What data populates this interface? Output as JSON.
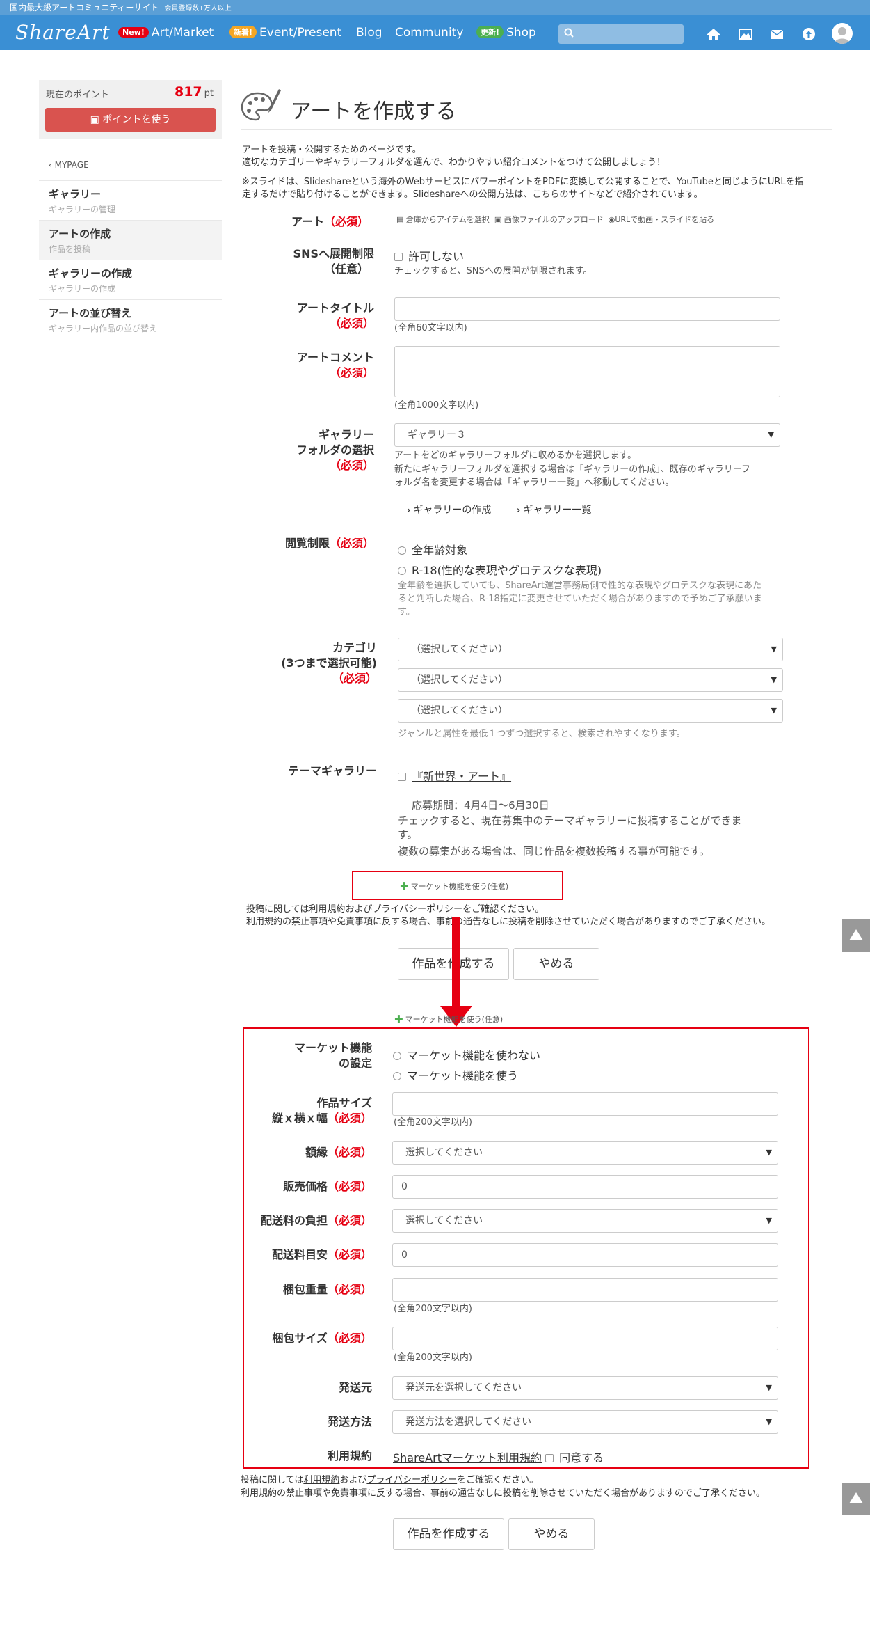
{
  "header": {
    "site_tagline": "国内最大級アートコミュニティーサイト",
    "member_count": "会員登録数1万人以上",
    "logo": "ShareArt",
    "nav": [
      {
        "badge": "New!",
        "label": "Art/Market"
      },
      {
        "badge": "新着!",
        "label": "Event/Present"
      },
      {
        "label": "Blog"
      },
      {
        "label": "Community"
      },
      {
        "badge": "更新!",
        "label": "Shop"
      }
    ],
    "search_placeholder": "",
    "icons": [
      "search-icon",
      "home-icon",
      "gallery-icon",
      "mail-icon",
      "upload-icon",
      "avatar"
    ]
  },
  "sidebar": {
    "points_label": "現在のポイント",
    "points_value": "817",
    "points_unit": "pt",
    "use_points_button": "ポイントを使う",
    "back_link": "MYPAGE",
    "items": [
      {
        "title": "ギャラリー",
        "sub": "ギャラリーの管理"
      },
      {
        "title": "アートの作成",
        "sub": "作品を投稿"
      },
      {
        "title": "ギャラリーの作成",
        "sub": "ギャラリーの作成"
      },
      {
        "title": "アートの並び替え",
        "sub": "ギャラリー内作品の並び替え"
      }
    ]
  },
  "main": {
    "title": "アートを作成する",
    "intro_line1": "アートを投稿・公開するためのページです。",
    "intro_line2": "適切なカテゴリーやギャラリーフォルダを選んで、わかりやすい紹介コメントをつけて公開しましょう！",
    "intro_line3": "※スライドは、Slideshareという海外のWebサービスにパワーポイントをPDFに変換して公開することで、YouTubeと同じようにURLを指",
    "intro_line4a": "定するだけで貼り付けることができます。Slideshareへの公開方法は、",
    "intro_line4_link": "こちらのサイト",
    "intro_line4b": "などで紹介されています。",
    "required": "（必須）",
    "optional_label": "（任意）",
    "art_label": "アート",
    "art_options": [
      "倉庫からアイテムを選択",
      "画像ファイルのアップロード",
      "URLで動画・スライドを貼る"
    ],
    "sns_label": "SNSへ展開制限",
    "sns_checkbox": "許可しない",
    "sns_hint": "チェックすると、SNSへの展開が制限されます。",
    "title_label": "アートタイトル",
    "title_hint": "(全角60文字以内)",
    "comment_label": "アートコメント",
    "comment_hint": "(全角1000文字以内)",
    "gallery_label1": "ギャラリー",
    "gallery_label2": "フォルダの選択",
    "gallery_selected": "ギャラリー３",
    "gallery_hint1": "アートをどのギャラリーフォルダに収めるかを選択します。",
    "gallery_hint2": "新たにギャラリーフォルダを選択する場合は「ギャラリーの作成」、既存のギャラリーフ",
    "gallery_hint3": "ォルダ名を変更する場合は「ギャラリー一覧」へ移動してください。",
    "gallery_link_create": "ギャラリーの作成",
    "gallery_link_list": "ギャラリー一覧",
    "rating_label": "閲覧制限",
    "rating_options": [
      "全年齢対象",
      "R-18(性的な表現やグロテスクな表現)"
    ],
    "rating_hint1": "全年齢を選択していても、ShareArt運営事務局側で性的な表現やグロテスクな表現にあた",
    "rating_hint2": "ると判断した場合、R-18指定に変更させていただく場合がありますので予めご了承願いま",
    "rating_hint3": "す。",
    "category_label1": "カテゴリ",
    "category_label2": "(3つまで選択可能)",
    "category_placeholder": "（選択してください）",
    "category_hint": "ジャンルと属性を最低１つずつ選択すると、検索されやすくなります。",
    "theme_label": "テーマギャラリー",
    "theme_link": "『新世界・アート』",
    "theme_period": "応募期間：4月4日〜6月30日",
    "theme_hint1": "チェックすると、現在募集中のテーマギャラリーに投稿することができま",
    "theme_hint2": "す。",
    "theme_hint3": "複数の募集がある場合は、同じ作品を複数投稿する事が可能です。",
    "market_toggle": "マーケット機能を使う(任意)",
    "terms_line1a": "投稿に関しては",
    "terms_link1": "利用規約",
    "terms_line1b": "および",
    "terms_link2": "プライバシーポリシー",
    "terms_line1c": "をご確認ください。",
    "terms_line2": "利用規約の禁止事項や免責事項に反する場合、事前の通告なしに投稿を削除させていただく場合がありますのでご了承ください。",
    "submit_button": "作品を作成する",
    "cancel_button": "やめる"
  },
  "market": {
    "toggle": "マーケット機能を使う(任意)",
    "setting_label1": "マーケット機能",
    "setting_label2": "の設定",
    "setting_options": [
      "マーケット機能を使わない",
      "マーケット機能を使う"
    ],
    "size_label1": "作品サイズ",
    "size_label2": "縦ｘ横ｘ幅",
    "size_hint": "(全角200文字以内)",
    "frame_label": "額縁",
    "frame_placeholder": "選択してください",
    "price_label": "販売価格",
    "price_value": "0",
    "shipping_burden_label": "配送料の負担",
    "shipping_burden_placeholder": "選択してください",
    "shipping_estimate_label": "配送料目安",
    "shipping_estimate_value": "0",
    "weight_label": "梱包重量",
    "weight_hint": "(全角200文字以内)",
    "pack_size_label": "梱包サイズ",
    "pack_size_hint": "(全角200文字以内)",
    "origin_label": "発送元",
    "origin_placeholder": "発送元を選択してください",
    "method_label": "発送方法",
    "method_placeholder": "発送方法を選択してください",
    "terms_label": "利用規約",
    "terms_link": "ShareArtマーケット利用規約",
    "terms_agree": "同意する"
  },
  "colors": {
    "accent": "#3a8fd4",
    "required": "#e60012",
    "points_button": "#d9534f"
  }
}
